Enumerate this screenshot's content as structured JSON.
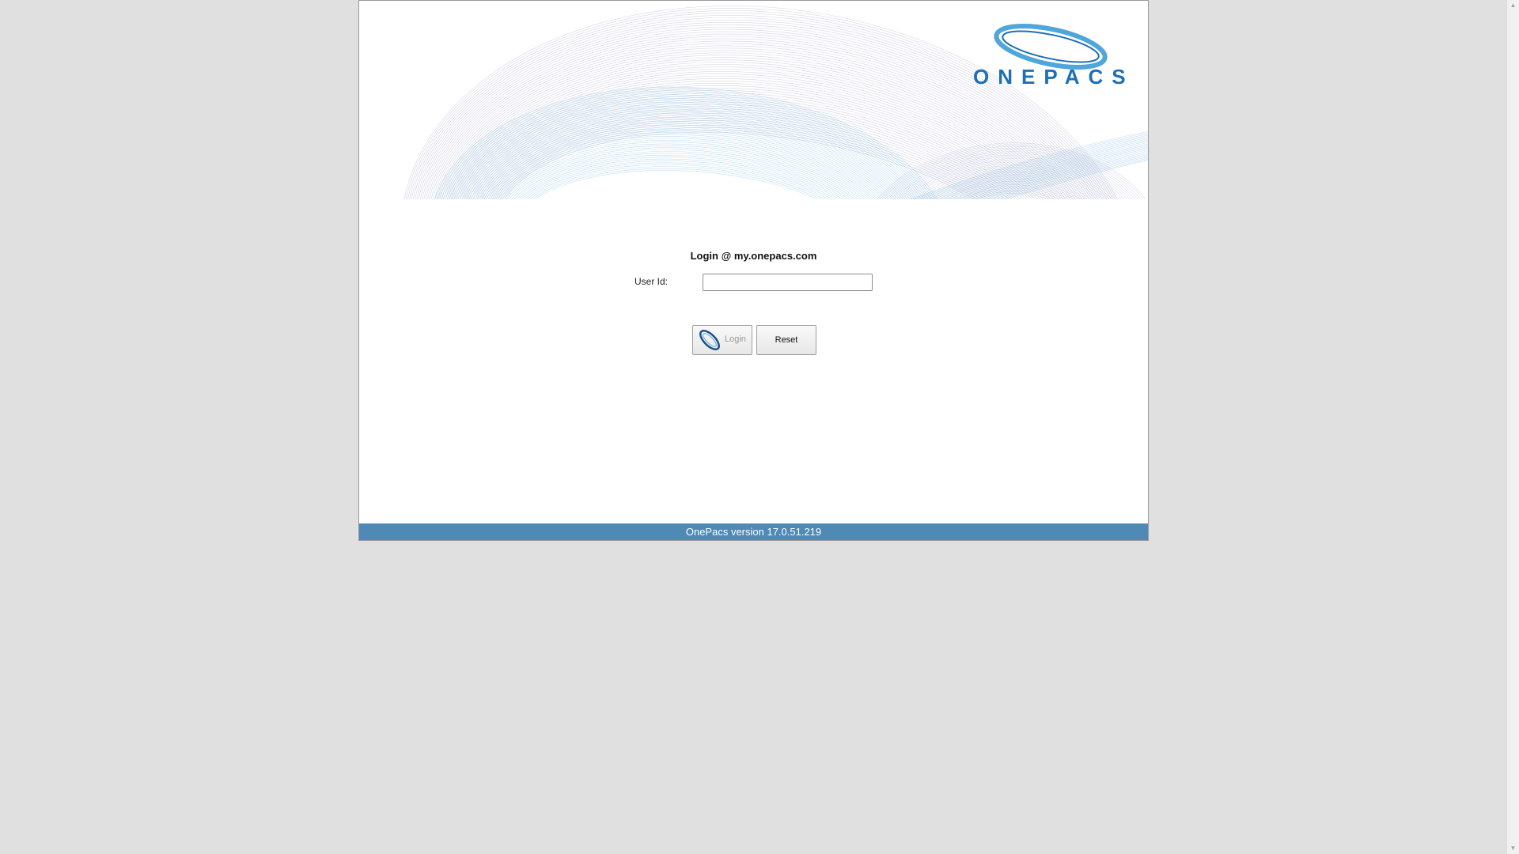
{
  "brand": {
    "logo_text": "ONEPACS",
    "logo_color": "#1d6fb8",
    "logo_swoosh_color": "#4fa6d8"
  },
  "login": {
    "title": "Login @ my.onepacs.com",
    "userid_label": "User Id:",
    "userid_value": "",
    "login_button_label": "Login",
    "reset_button_label": "Reset"
  },
  "footer": {
    "version_text": "OnePacs version 17.0.51.219",
    "color": "#4f89b5"
  },
  "icons": {
    "login_button_icon": "onepacs-swoosh-icon",
    "scroll_up": "scroll-up-arrow-icon",
    "scroll_down": "scroll-down-arrow-icon"
  }
}
